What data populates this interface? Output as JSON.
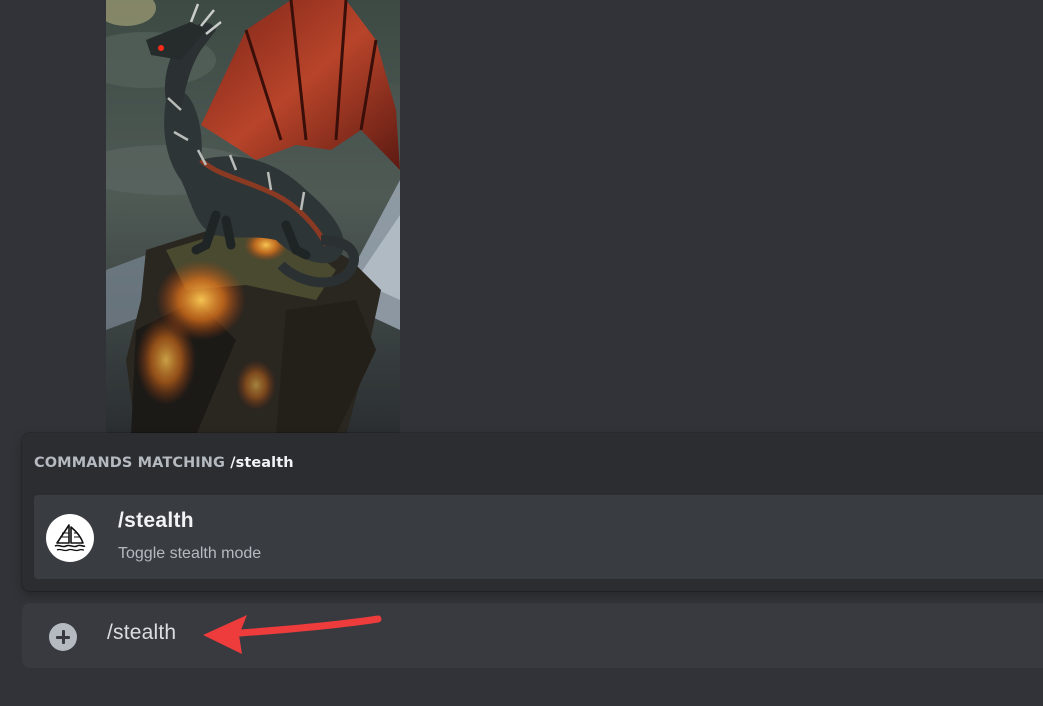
{
  "image": {
    "subject": "dragon-artwork"
  },
  "autocomplete": {
    "header_prefix": "COMMANDS MATCHING",
    "header_query": "/stealth",
    "commands": [
      {
        "name": "/stealth",
        "description": "Toggle stealth mode",
        "icon": "midjourney-sailboat-icon"
      }
    ]
  },
  "input": {
    "value": "/stealth",
    "attach_icon": "plus-circle-icon"
  },
  "colors": {
    "background": "#313338",
    "popup": "#2b2d31",
    "row": "#393c41",
    "input_bg": "#383a40",
    "arrow": "#ee3b3b"
  }
}
